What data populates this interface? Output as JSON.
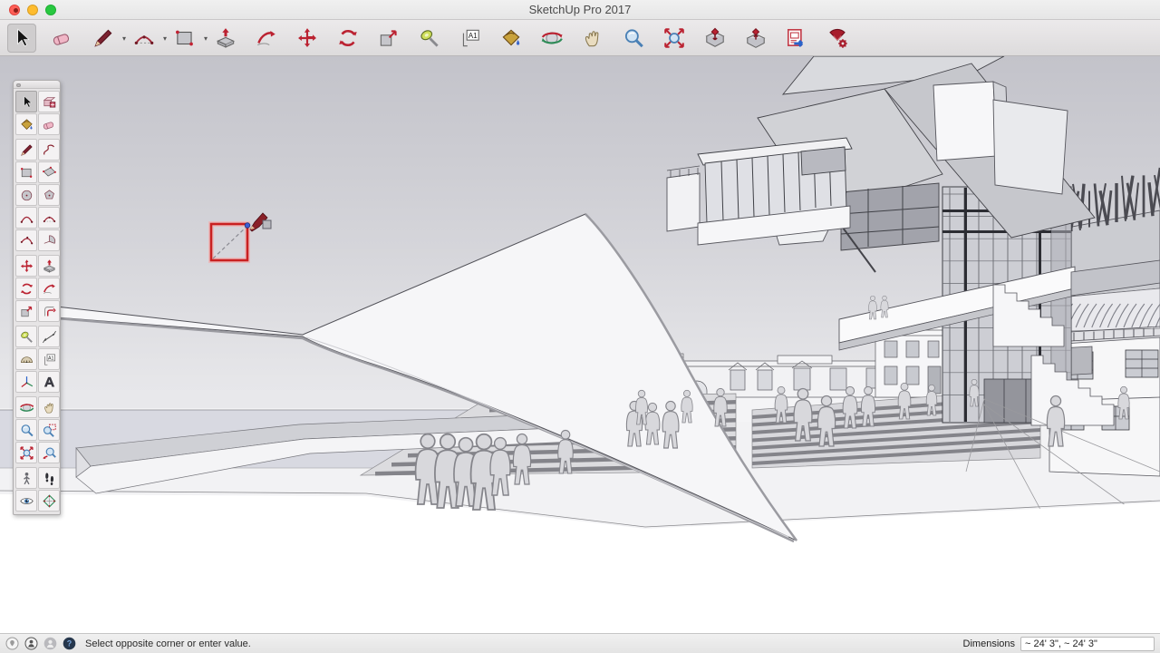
{
  "window": {
    "title": "SketchUp Pro 2017"
  },
  "toolbar": {
    "items": [
      {
        "id": "select",
        "label": "Select",
        "selected": true
      },
      {
        "id": "eraser",
        "label": "Eraser"
      },
      {
        "id": "line",
        "label": "Line",
        "dropdown": true
      },
      {
        "id": "two-point-arc",
        "label": "Arcs",
        "dropdown": true
      },
      {
        "id": "rectangle",
        "label": "Shapes",
        "dropdown": true
      },
      {
        "id": "push-pull",
        "label": "Push/Pull"
      },
      {
        "id": "follow-me",
        "label": "Follow Me"
      },
      {
        "id": "move",
        "label": "Move"
      },
      {
        "id": "rotate",
        "label": "Rotate"
      },
      {
        "id": "scale",
        "label": "Scale"
      },
      {
        "id": "tape-measure",
        "label": "Tape Measure"
      },
      {
        "id": "text",
        "label": "Text"
      },
      {
        "id": "paint-bucket",
        "label": "Paint Bucket"
      },
      {
        "id": "orbit",
        "label": "Orbit"
      },
      {
        "id": "pan",
        "label": "Pan"
      },
      {
        "id": "zoom",
        "label": "Zoom"
      },
      {
        "id": "zoom-extents",
        "label": "Zoom Extents"
      },
      {
        "id": "get-models",
        "label": "Get Models"
      },
      {
        "id": "share-model",
        "label": "Share Model"
      },
      {
        "id": "send-to-layout",
        "label": "Send to LayOut"
      },
      {
        "id": "extension-warehouse",
        "label": "Extension Warehouse"
      }
    ]
  },
  "tool_palette": {
    "selected": "select",
    "groups": [
      [
        "select",
        "make-component",
        "paint-bucket",
        "eraser"
      ],
      [
        "line",
        "freehand",
        "rectangle",
        "rotated-rectangle",
        "circle",
        "polygon",
        "arc",
        "two-point-arc",
        "three-point-arc",
        "pie"
      ],
      [
        "move",
        "push-pull",
        "rotate",
        "follow-me",
        "scale",
        "offset"
      ],
      [
        "tape-measure",
        "dimension",
        "protractor",
        "text",
        "axes",
        "3d-text"
      ],
      [
        "orbit",
        "pan",
        "zoom",
        "zoom-window",
        "zoom-extents",
        "zoom-previous"
      ],
      [
        "position-camera",
        "walk",
        "look-around",
        "section-plane"
      ]
    ],
    "labels": {
      "select": "Select",
      "make-component": "Make Component",
      "paint-bucket": "Paint Bucket",
      "eraser": "Eraser",
      "line": "Line",
      "freehand": "Freehand",
      "rectangle": "Rectangle",
      "rotated-rectangle": "Rotated Rectangle",
      "circle": "Circle",
      "polygon": "Polygon",
      "arc": "Arc",
      "two-point-arc": "2 Point Arc",
      "three-point-arc": "3 Point Arc",
      "pie": "Pie",
      "move": "Move",
      "push-pull": "Push/Pull",
      "rotate": "Rotate",
      "follow-me": "Follow Me",
      "scale": "Scale",
      "offset": "Offset",
      "tape-measure": "Tape Measure",
      "dimension": "Dimension",
      "protractor": "Protractor",
      "text": "Text",
      "axes": "Axes",
      "3d-text": "3D Text",
      "orbit": "Orbit",
      "pan": "Pan",
      "zoom": "Zoom",
      "zoom-window": "Zoom Window",
      "zoom-extents": "Zoom Extents",
      "zoom-previous": "Zoom Previous",
      "position-camera": "Position Camera",
      "walk": "Walk",
      "look-around": "Look Around",
      "section-plane": "Section Plane"
    }
  },
  "viewport": {
    "overlay": {
      "tool": "rectangle",
      "stroke_color": "#c92121",
      "endpoint_color": "#3d5fd4"
    }
  },
  "status_bar": {
    "icons": [
      "geolocation",
      "credit-attribution",
      "sign-in",
      "help"
    ],
    "hint": "Select opposite corner or enter value.",
    "dimensions_label": "Dimensions",
    "dimensions_value": "~ 24' 3\", ~ 24' 3\""
  },
  "colors": {
    "accent_red": "#c92121",
    "titlebar_bg": "#ececec",
    "toolbar_bg": "#e3e1e2",
    "sky_top": "#c3c3ca",
    "sky_bottom": "#e9e9ec",
    "traffic_close": "#ff5f57",
    "traffic_minimize": "#febc2e",
    "traffic_zoom": "#28c840"
  }
}
